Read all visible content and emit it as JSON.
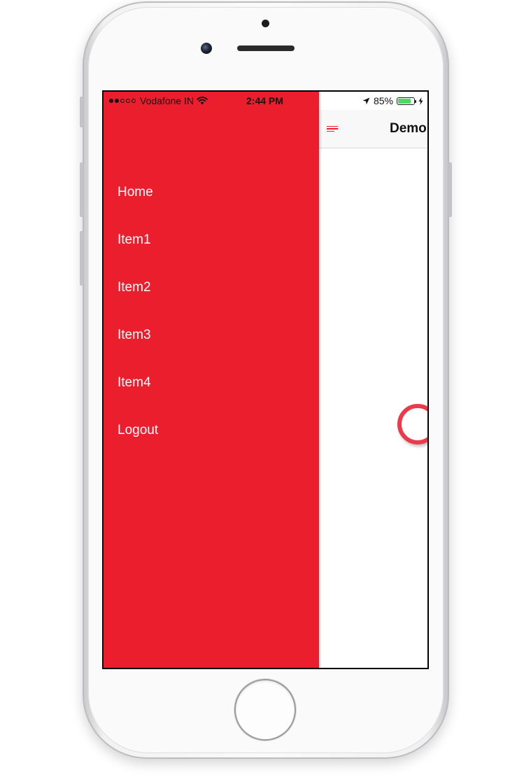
{
  "status_bar": {
    "carrier": "Vodafone IN",
    "signal_bars_filled": 2,
    "signal_bars_total": 5,
    "time": "2:44 PM",
    "battery_percent_label": "85%",
    "battery_level": 0.85,
    "battery_color": "#4cd964",
    "icons": [
      "wifi-icon",
      "location-arrow-icon",
      "battery-icon",
      "charging-bolt-icon"
    ]
  },
  "nav_bar": {
    "title": "Demo",
    "menu_icon": "hamburger-menu-icon",
    "accent_color": "#ec1f2e"
  },
  "drawer": {
    "background_color": "#eb1e2d",
    "items": [
      {
        "label": "Home"
      },
      {
        "label": "Item1"
      },
      {
        "label": "Item2"
      },
      {
        "label": "Item3"
      },
      {
        "label": "Item4"
      },
      {
        "label": "Logout"
      }
    ]
  },
  "content": {
    "loading_indicator": "loading-spinner-icon",
    "spinner_color": "#ec3a4a"
  }
}
